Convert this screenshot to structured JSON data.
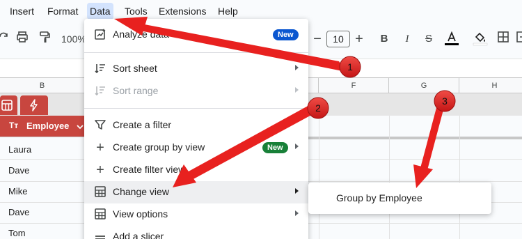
{
  "menubar": {
    "items": [
      "Insert",
      "Format",
      "Data",
      "Tools",
      "Extensions",
      "Help"
    ]
  },
  "toolbar": {
    "zoom": "100%",
    "font_size": "10"
  },
  "columns": [
    "B",
    "F",
    "G",
    "H"
  ],
  "table": {
    "header_label": "Employee",
    "header_type_icon": "Tт",
    "rows": [
      "Laura",
      "Dave",
      "Mike",
      "Dave",
      "Tom"
    ]
  },
  "dropdown": {
    "items": [
      {
        "icon": "analyze-data-icon",
        "label": "Analyze data",
        "badge": "New"
      },
      {
        "icon": "sort-icon",
        "label": "Sort sheet"
      },
      {
        "icon": "sort-icon",
        "label": "Sort range"
      },
      {
        "icon": "filter-icon",
        "label": "Create a filter"
      },
      {
        "icon": "plus-icon",
        "label": "Create group by view",
        "badge": "New"
      },
      {
        "icon": "plus-icon",
        "label": "Create filter view"
      },
      {
        "icon": "table-icon",
        "label": "Change view"
      },
      {
        "icon": "table-icon",
        "label": "View options"
      },
      {
        "icon": "slicer-icon",
        "label": "Add a slicer"
      }
    ]
  },
  "submenu": {
    "item": "Group by Employee"
  },
  "annotations": [
    "1",
    "2",
    "3"
  ],
  "colors": {
    "accent_red": "#c8463f",
    "badge_blue": "#0b57d0",
    "badge_green": "#188038",
    "arrow_red": "#e8211f",
    "menu_highlight": "#d3e3fd"
  }
}
